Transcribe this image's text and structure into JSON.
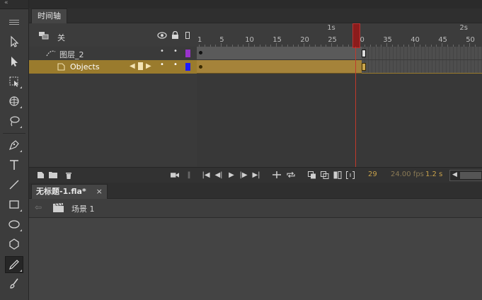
{
  "toolbar": {
    "collapse_glyph": "«",
    "tools": [
      {
        "name": "selection-tool-icon"
      },
      {
        "name": "subselection-tool-icon"
      },
      {
        "name": "free-transform-tool-icon"
      },
      {
        "name": "3d-rotation-tool-icon"
      },
      {
        "name": "lasso-tool-icon"
      },
      {
        "name": "pen-tool-icon"
      },
      {
        "name": "text-tool-icon"
      },
      {
        "name": "line-tool-icon"
      },
      {
        "name": "rectangle-tool-icon"
      },
      {
        "name": "oval-tool-icon"
      },
      {
        "name": "polystar-tool-icon"
      },
      {
        "name": "pencil-tool-icon"
      },
      {
        "name": "brush-tool-icon"
      }
    ],
    "active_tool": "pencil-tool-icon"
  },
  "timeline": {
    "tab_label": "时间轴",
    "header": {
      "layer_label": "关"
    },
    "ruler": {
      "frame_numbers": [
        "1",
        "5",
        "10",
        "15",
        "20",
        "25",
        "30",
        "35",
        "40",
        "45",
        "50"
      ],
      "seconds": [
        "1s",
        "2s"
      ]
    },
    "layers": [
      {
        "name": "图层_2",
        "selected": false,
        "color": "#9933cc"
      },
      {
        "name": "Objects",
        "selected": true,
        "color": "#1a1aff"
      }
    ],
    "status": {
      "current_frame": "29",
      "fps": "24.00 fps",
      "elapsed": "1.2 s"
    }
  },
  "document": {
    "tab_label": "无标题-1.fla*",
    "close_glyph": "×",
    "scene_label": "场景 1"
  },
  "colors": {
    "selected_layer": "#9a7b2d",
    "playhead": "#c0392b",
    "status_text": "#c8a24a"
  }
}
